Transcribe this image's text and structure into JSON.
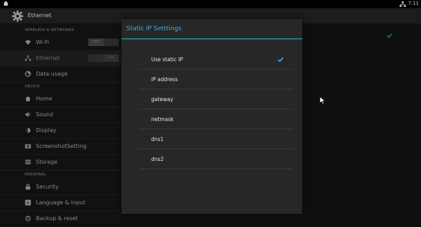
{
  "statusbar": {
    "time": "7:11"
  },
  "actionbar": {
    "title": "Ethernet"
  },
  "sidebar": {
    "headers": {
      "wireless": "WIRELESS & NETWORKS",
      "device": "DEVICE",
      "personal": "PERSONAL"
    },
    "items": [
      {
        "label": "Wi-Fi",
        "icon": "wifi-icon",
        "toggle": "OFF"
      },
      {
        "label": "Ethernet",
        "icon": "ethernet-icon",
        "toggle": "ON"
      },
      {
        "label": "Data usage",
        "icon": "data-usage-icon"
      },
      {
        "label": "Home",
        "icon": "home-icon"
      },
      {
        "label": "Sound",
        "icon": "sound-icon"
      },
      {
        "label": "Display",
        "icon": "display-icon"
      },
      {
        "label": "ScreenshotSetting",
        "icon": "screenshot-icon"
      },
      {
        "label": "Storage",
        "icon": "storage-icon"
      },
      {
        "label": "Security",
        "icon": "lock-icon"
      },
      {
        "label": "Language & input",
        "icon": "language-icon"
      },
      {
        "label": "Backup & reset",
        "icon": "backup-icon"
      }
    ]
  },
  "dialog": {
    "title": "Static IP Setttings",
    "rows": [
      {
        "label": "Use static IP",
        "checked": true
      },
      {
        "label": "IP address"
      },
      {
        "label": "gateway"
      },
      {
        "label": "netmask"
      },
      {
        "label": "dns1"
      },
      {
        "label": "dns2"
      }
    ]
  },
  "colors": {
    "accent": "#33b5e5"
  }
}
